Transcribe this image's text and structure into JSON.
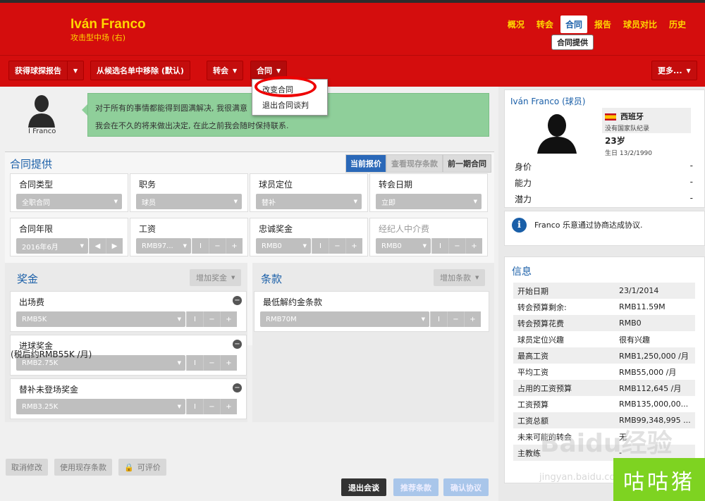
{
  "header": {
    "player_name": "Iván Franco",
    "player_role": "攻击型中场 (右)",
    "tabs": [
      "概况",
      "转会",
      "合同",
      "报告",
      "球员对比",
      "历史"
    ],
    "active_tab": "合同",
    "tooltip": "合同提供"
  },
  "toolbar": {
    "scout_report": "获得球探报告",
    "remove_shortlist": "从候选名单中移除 (默认)",
    "transfer": "转会",
    "contract": "合同",
    "more": "更多..."
  },
  "contract_menu": {
    "items": [
      "改变合同",
      "退出合同谈判"
    ]
  },
  "message": {
    "avatar_name": "I Franco",
    "line1": "对于所有的事情都能得到圆满解决, 我很满意",
    "line2": "我会在不久的将来做出决定, 在此之前我会随时保持联系."
  },
  "offer": {
    "title": "合同提供",
    "segments": [
      "当前报价",
      "查看现存条款",
      "前一期合同"
    ],
    "fields": [
      {
        "label": "合同类型",
        "value": "全职合同"
      },
      {
        "label": "职务",
        "value": "球员"
      },
      {
        "label": "球员定位",
        "value": "替补"
      },
      {
        "label": "转会日期",
        "value": "立即"
      },
      {
        "label": "合同年限",
        "value": "2016年6月"
      },
      {
        "label": "工资",
        "value": "RMB97..."
      },
      {
        "label": "忠诚奖金",
        "value": "RMB0"
      },
      {
        "label": "经纪人中介费",
        "value": "RMB0"
      }
    ]
  },
  "bonus": {
    "title": "奖金",
    "add": "增加奖金",
    "items": [
      {
        "label": "出场费",
        "value": "RMB5K"
      },
      {
        "label": "进球奖金",
        "value": "RMB2.75K"
      },
      {
        "label": "替补未登场奖金",
        "value": "RMB3.25K"
      }
    ]
  },
  "clauses": {
    "title": "条款",
    "add": "增加条款",
    "items": [
      {
        "label": "最低解约金条款",
        "value": "RMB70M"
      }
    ]
  },
  "footer": {
    "salary_note": "(税后约RMB55K /月)",
    "cancel": "取消修改",
    "use_existing": "使用现存条款",
    "negotiable": "可评价",
    "exit": "退出会谈",
    "suggest": "推荐条款",
    "confirm": "确认协议"
  },
  "side": {
    "title": "Iván Franco (球员)",
    "country": "西班牙",
    "intl": "没有国家队纪录",
    "age": "23岁",
    "born": "生日 13/2/1990",
    "attrs": [
      {
        "label": "身价",
        "value": "-"
      },
      {
        "label": "能力",
        "value": "-"
      },
      {
        "label": "潜力",
        "value": "-"
      }
    ],
    "notice": "Franco 乐意通过协商达成协议.",
    "info_title": "信息",
    "info": [
      {
        "k": "开始日期",
        "v": "23/1/2014"
      },
      {
        "k": "转会预算剩余:",
        "v": "RMB11.59M"
      },
      {
        "k": "转会预算花费",
        "v": "RMB0"
      },
      {
        "k": "球员定位兴趣",
        "v": "很有兴趣"
      },
      {
        "k": "最高工资",
        "v": "RMB1,250,000 /月"
      },
      {
        "k": "平均工资",
        "v": "RMB55,000 /月"
      },
      {
        "k": "占用的工资预算",
        "v": "RMB112,645 /月"
      },
      {
        "k": "工资预算",
        "v": "RMB135,000,00..."
      },
      {
        "k": "工资总额",
        "v": "RMB99,348,995 ..."
      },
      {
        "k": "未来可能的转会",
        "v": "无"
      },
      {
        "k": "主教练",
        "v": "-"
      }
    ]
  },
  "watermark": {
    "text": "Baidu经验",
    "sub": "jingyan.baidu.com",
    "corner": "咕咕猪"
  }
}
